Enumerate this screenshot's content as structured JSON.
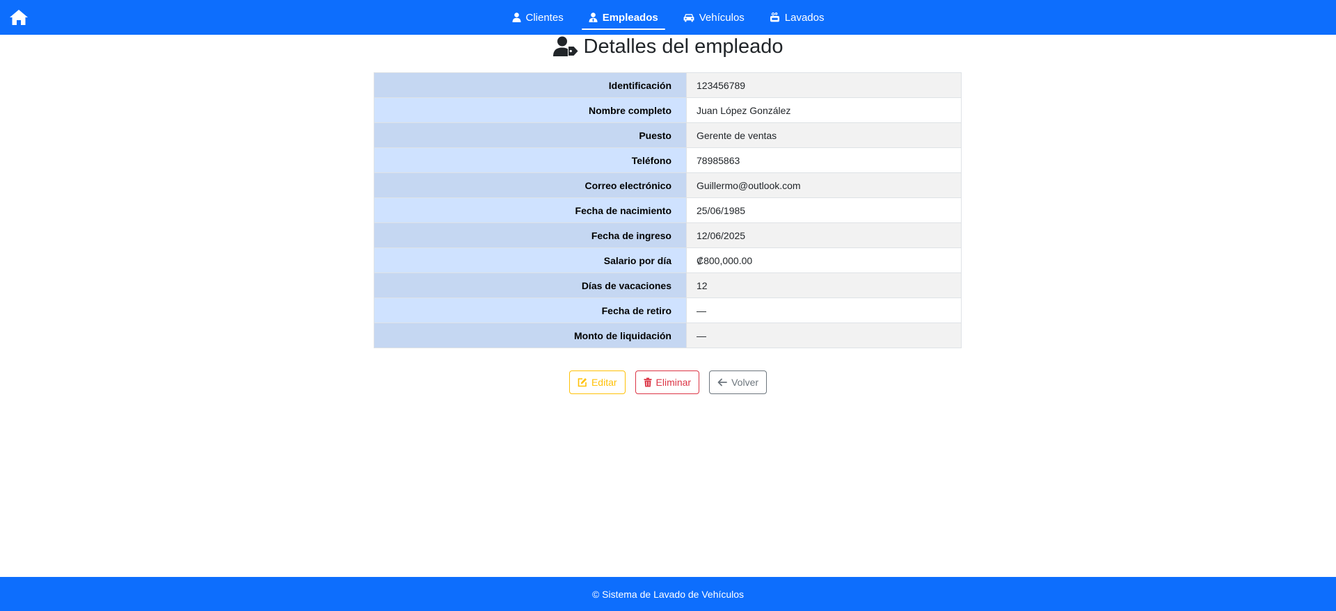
{
  "nav": {
    "home_icon": "home-icon",
    "items": [
      {
        "label": "Clientes",
        "icon": "user-icon",
        "active": false
      },
      {
        "label": "Empleados",
        "icon": "user-tie-icon",
        "active": true
      },
      {
        "label": "Vehículos",
        "icon": "car-icon",
        "active": false
      },
      {
        "label": "Lavados",
        "icon": "soap-icon",
        "active": false
      }
    ]
  },
  "page": {
    "title": "Detalles del empleado",
    "title_icon": "user-tag-icon"
  },
  "details": [
    {
      "label": "Identificación",
      "value": "123456789"
    },
    {
      "label": "Nombre completo",
      "value": "Juan López González"
    },
    {
      "label": "Puesto",
      "value": "Gerente de ventas"
    },
    {
      "label": "Teléfono",
      "value": "78985863"
    },
    {
      "label": "Correo electrónico",
      "value": "Guillermo@outlook.com"
    },
    {
      "label": "Fecha de nacimiento",
      "value": "25/06/1985"
    },
    {
      "label": "Fecha de ingreso",
      "value": "12/06/2025"
    },
    {
      "label": "Salario por día",
      "value": "₡800,000.00"
    },
    {
      "label": "Días de vacaciones",
      "value": "12"
    },
    {
      "label": "Fecha de retiro",
      "value": "—"
    },
    {
      "label": "Monto de liquidación",
      "value": "—"
    }
  ],
  "actions": {
    "edit_label": "Editar",
    "delete_label": "Eliminar",
    "back_label": "Volver"
  },
  "footer": {
    "text": "© Sistema de Lavado de Vehículos"
  },
  "colors": {
    "primary": "#0d6efd",
    "warning": "#ffc107",
    "danger": "#dc3545",
    "secondary": "#6c757d"
  }
}
